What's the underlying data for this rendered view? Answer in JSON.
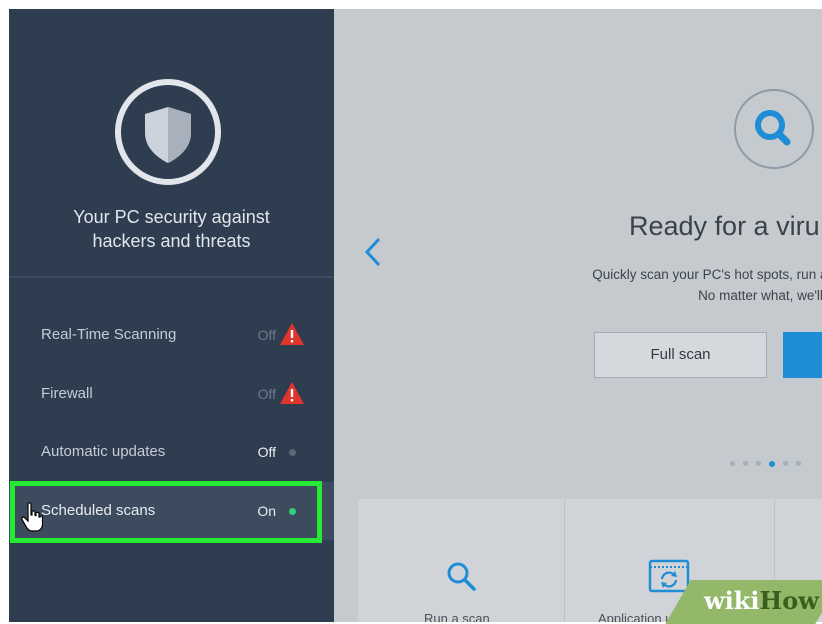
{
  "sidebar": {
    "tagline": [
      "Your PC security against",
      "hackers and threats"
    ],
    "items": [
      {
        "label": "Real-Time Scanning",
        "status": "Off",
        "indicator": "warning-icon"
      },
      {
        "label": "Firewall",
        "status": "Off",
        "indicator": "warning-icon"
      },
      {
        "label": "Automatic updates",
        "status": "Off",
        "indicator": "gray-dot"
      },
      {
        "label": "Scheduled scans",
        "status": "On",
        "indicator": "green-dot"
      }
    ]
  },
  "main": {
    "headline": "Ready for a viru",
    "description": [
      "Quickly scan your PC's hot spots, run a full scan, or do m",
      "No matter what, we'll scan quietly so yo"
    ],
    "full_scan_label": "Full scan",
    "carousel": {
      "total": 6,
      "active": 4
    },
    "tiles": [
      {
        "label": "Run a scan",
        "icon": "search-icon"
      },
      {
        "label": "Application updates",
        "icon": "refresh-window-icon"
      }
    ]
  },
  "watermark": {
    "part1": "wiki",
    "part2": "How"
  },
  "colors": {
    "sidebar_bg": "#2e3d4f",
    "main_bg": "#c5cacf",
    "accent_blue": "#1e8dd6",
    "highlight_green": "#27e934",
    "warning_red": "#e0352b",
    "status_on": "#33d07a"
  }
}
